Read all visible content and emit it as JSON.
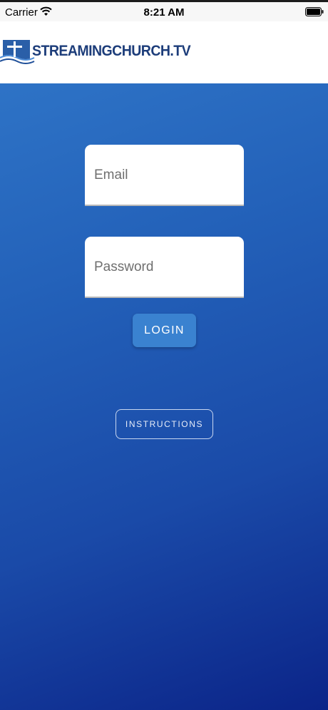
{
  "status_bar": {
    "carrier": "Carrier",
    "time": "8:21 AM",
    "icons": [
      "wifi-icon",
      "battery-icon"
    ]
  },
  "header": {
    "logo_text": "STREAMINGCHURCH.TV",
    "logo_icon": "cross-water-logo"
  },
  "login_form": {
    "email_placeholder": "Email",
    "email_value": "",
    "password_placeholder": "Password",
    "password_value": "",
    "login_label": "LOGIN",
    "instructions_label": "INSTRUCTIONS"
  },
  "colors": {
    "header_bg": "#ffffff",
    "gradient_top": "#2e73c6",
    "gradient_bottom": "#0b2488",
    "login_button": "#3a82d0",
    "logo_text": "#1d3d7a"
  }
}
